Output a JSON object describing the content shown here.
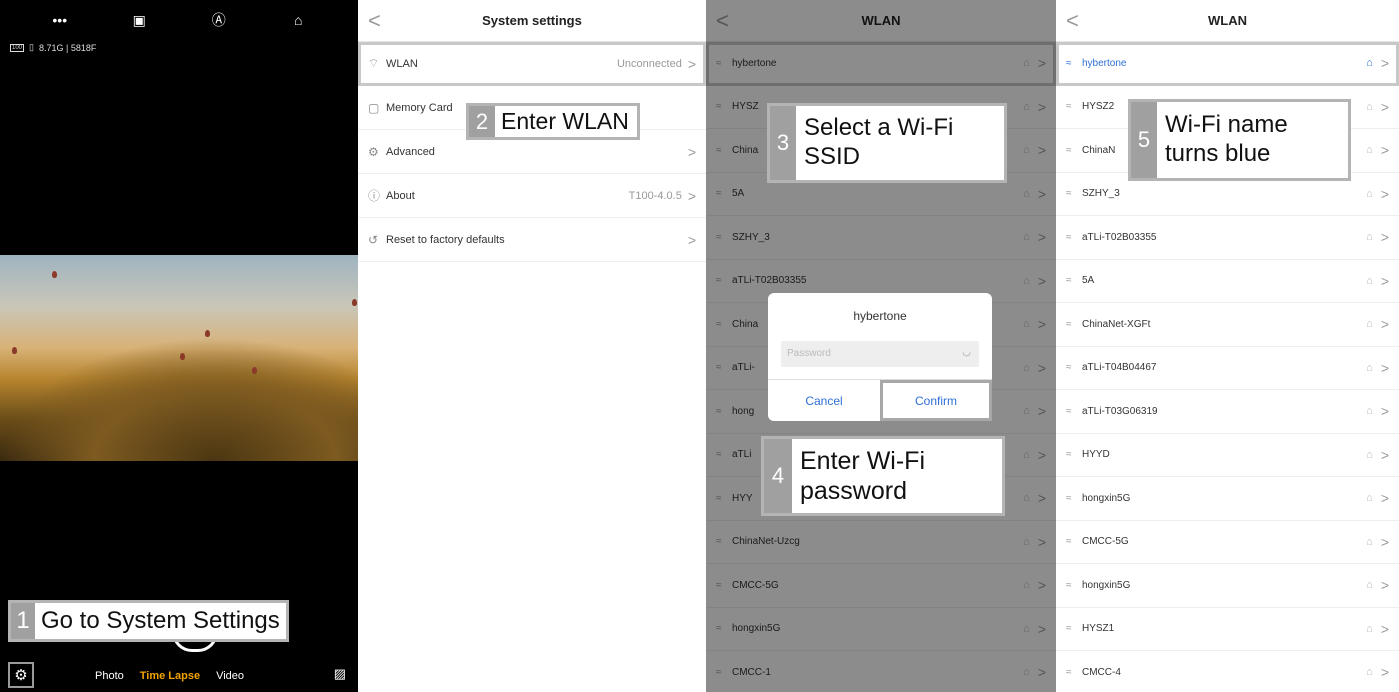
{
  "camera": {
    "top_icons": [
      "more-icon",
      "hdr-icon",
      "auto-icon",
      "home-icon"
    ],
    "top_glyphs": [
      "•••",
      "▣",
      "Ⓐ",
      "⌂"
    ],
    "status": "8.71G | 5818F",
    "battery": "100",
    "modes": [
      "Photo",
      "Time Lapse",
      "Video"
    ],
    "active_mode": "Time Lapse",
    "gear_glyph": "⚙",
    "gallery_glyph": "▨"
  },
  "settings": {
    "title": "System settings",
    "back": "<",
    "rows": [
      {
        "icon": "⌔",
        "label": "WLAN",
        "value": "Unconnected",
        "chev": ">"
      },
      {
        "icon": "▢",
        "label": "Memory Card",
        "value": "",
        "chev": ""
      },
      {
        "icon": "⚙",
        "label": "Advanced",
        "value": "",
        "chev": ">"
      },
      {
        "icon": "ⓘ",
        "label": "About",
        "value": "T100-4.0.5",
        "chev": ">"
      },
      {
        "icon": "↺",
        "label": "Reset to factory defaults",
        "value": "",
        "chev": ">"
      }
    ]
  },
  "wlan_dim": {
    "title": "WLAN",
    "back": "<",
    "networks": [
      "hybertone",
      "HYSZ",
      "China",
      "5A",
      "SZHY_3",
      "aTLi-T02B03355",
      "China",
      "aTLi-",
      "hong",
      "aTLi",
      "HYY",
      "ChinaNet-Uzcg",
      "CMCC-5G",
      "hongxin5G",
      "CMCC-1"
    ]
  },
  "dialog": {
    "title": "hybertone",
    "password_placeholder": "Password",
    "eye": "◡",
    "cancel": "Cancel",
    "confirm": "Confirm"
  },
  "wlan_result": {
    "title": "WLAN",
    "back": "<",
    "networks": [
      "hybertone",
      "HYSZ2",
      "ChinaN",
      "SZHY_3",
      "aTLi-T02B03355",
      "5A",
      "ChinaNet-XGFt",
      "aTLi-T04B04467",
      "aTLi-T03G06319",
      "HYYD",
      "hongxin5G",
      "CMCC-5G",
      "hongxin5G",
      "HYSZ1",
      "CMCC-4"
    ]
  },
  "wifi_glyph": "≈",
  "lock_glyph": "⌂",
  "chev_glyph": ">",
  "callouts": {
    "c1": {
      "num": "1",
      "text": "Go to System Settings"
    },
    "c2": {
      "num": "2",
      "text": "Enter WLAN"
    },
    "c3": {
      "num": "3",
      "line1": "Select a Wi-Fi",
      "line2": "SSID"
    },
    "c4": {
      "num": "4",
      "line1": "Enter Wi-Fi",
      "line2": "password"
    },
    "c5": {
      "num": "5",
      "line1": "Wi-Fi name",
      "line2": "turns blue"
    }
  },
  "colors": {
    "accent": "#2f6fd6",
    "mode_active": "#f2a300",
    "callout_num": "#a0a0a0"
  }
}
